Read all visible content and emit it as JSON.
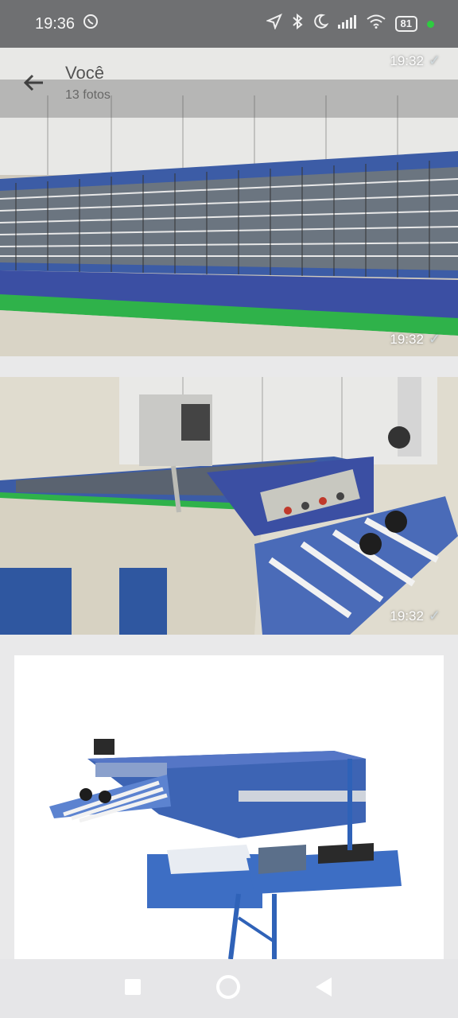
{
  "status_bar": {
    "time": "19:36",
    "battery": "81"
  },
  "header": {
    "title": "Você",
    "subtitle": "13 fotos"
  },
  "photos": [
    {
      "time": "19:32",
      "description_icon": "photo-folding-machine-conveyor"
    },
    {
      "time": "19:32",
      "description_icon": "photo-folding-machine-control"
    },
    {
      "time": "",
      "description_icon": "photo-folding-machine-product"
    }
  ],
  "photo1_top_time": "19:32",
  "nav": {
    "square": "recents-icon",
    "circle": "home-icon",
    "triangle": "back-nav-icon"
  },
  "colors": {
    "accent_blue": "#3a5ba8",
    "accent_green": "#2fb24a",
    "status_bg": "#6f7072"
  }
}
